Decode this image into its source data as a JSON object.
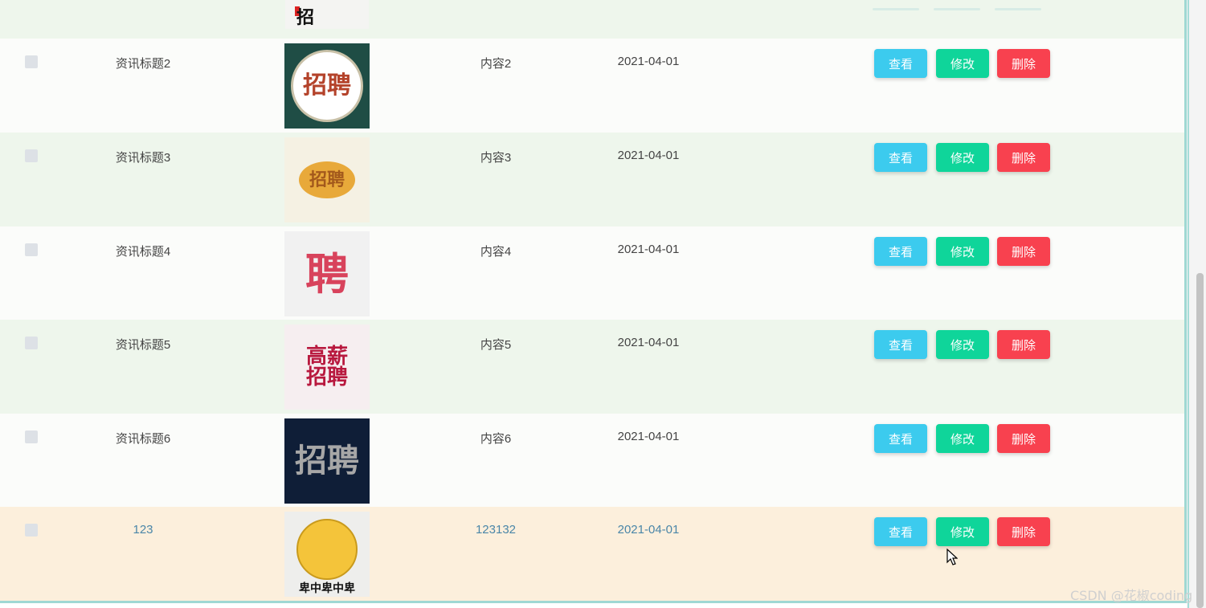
{
  "table": {
    "rows": [
      {
        "title": "资讯标题2",
        "content": "内容2",
        "date": "2021-04-01",
        "image": {
          "text": "招聘",
          "bg": "#1f4d45",
          "fg": "#b4432b",
          "style": "circle"
        }
      },
      {
        "title": "资讯标题3",
        "content": "内容3",
        "date": "2021-04-01",
        "image": {
          "text": "招聘",
          "bg": "#f5f1e3",
          "fg": "#a3591c",
          "style": "ball"
        }
      },
      {
        "title": "资讯标题4",
        "content": "内容4",
        "date": "2021-04-01",
        "image": {
          "text": "聘",
          "bg": "#f1f1f1",
          "fg": "#d8435c",
          "style": "plain"
        }
      },
      {
        "title": "资讯标题5",
        "content": "内容5",
        "date": "2021-04-01",
        "image": {
          "text": "高薪招聘",
          "bg": "#f6eef0",
          "fg": "#b8183e",
          "style": "plain"
        }
      },
      {
        "title": "资讯标题6",
        "content": "内容6",
        "date": "2021-04-01",
        "image": {
          "text": "招聘",
          "bg": "#0f1e37",
          "fg": "#a7a7a7",
          "style": "plain"
        }
      },
      {
        "title": "123",
        "content": "123132",
        "date": "2021-04-01",
        "image": {
          "text": "卑中卑中卑",
          "bg": "#eeeeec",
          "fg": "#111111",
          "style": "smiley"
        }
      }
    ],
    "actions": {
      "view_label": "查看",
      "edit_label": "修改",
      "delete_label": "删除"
    }
  },
  "colors": {
    "view": "#3ccbee",
    "edit": "#0fd59a",
    "delete": "#f8414f",
    "row_even": "#eef6ec",
    "row_odd": "#fbfcfa",
    "row_hover": "#fcefdc"
  },
  "watermark": "CSDN @花椒coding"
}
